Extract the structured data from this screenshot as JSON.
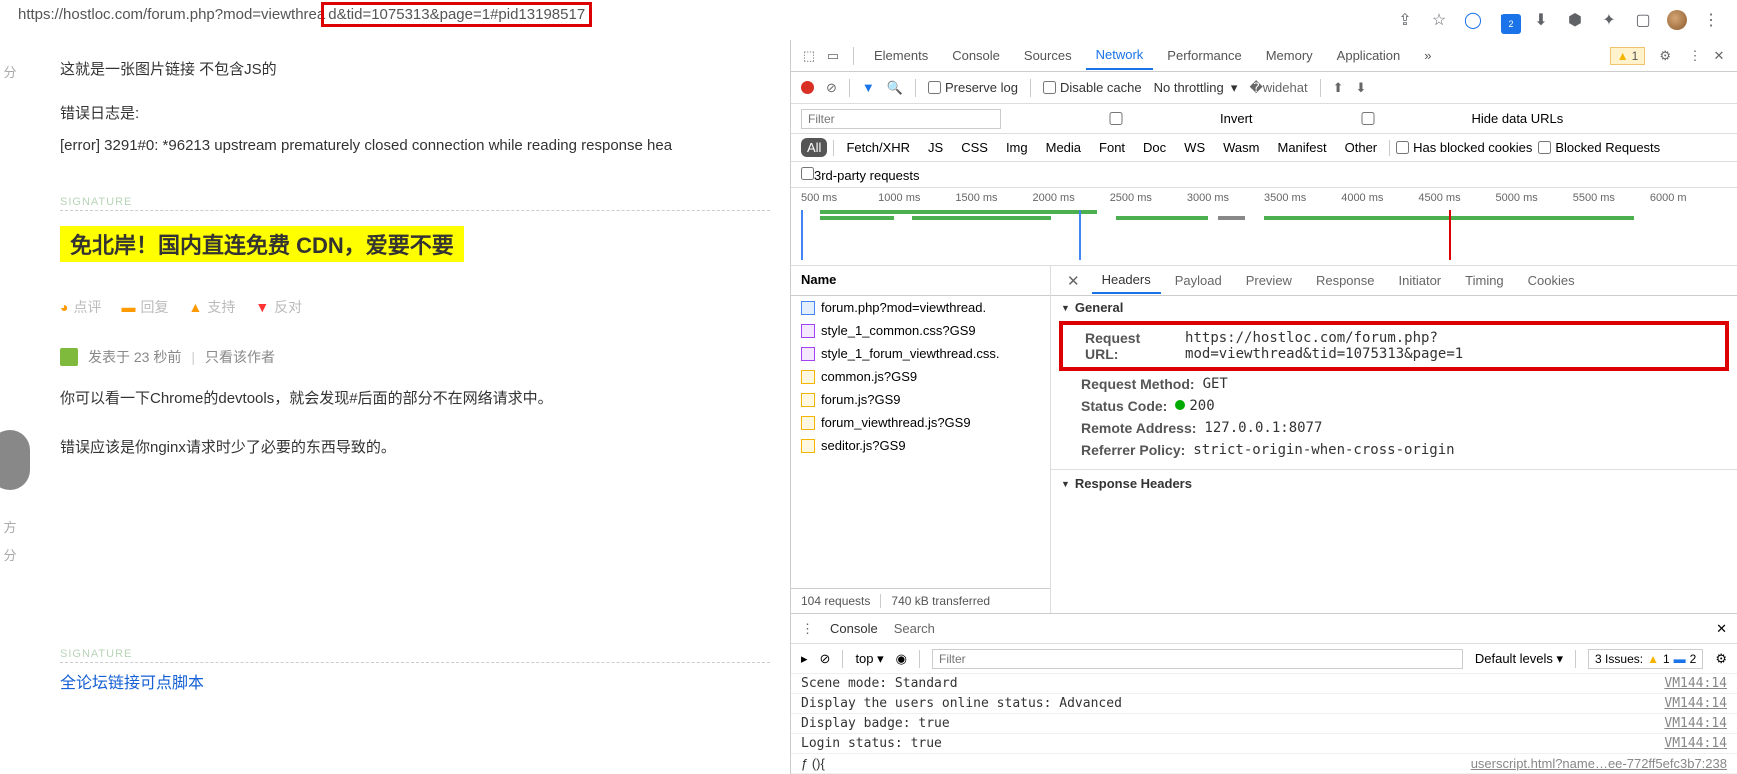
{
  "browser": {
    "url_prefix": "https://hostloc.com/forum.php?mod=viewthrea",
    "url_highlight": "d&tid=1075313&page=1#pid13198517",
    "extension_badge": "2"
  },
  "forum": {
    "sidebar1": "分",
    "sidebar2_a": "方",
    "sidebar2_b": "分",
    "post1_line1": "这就是一张图片链接   不包含JS的",
    "post1_line2": "错误日志是:",
    "post1_line3": "[error] 3291#0: *96213 upstream prematurely closed connection while reading response hea",
    "signature": "SIGNATURE",
    "banner": "免北岸！国内直连免费 CDN，爱要不要",
    "actions": {
      "comment": "点评",
      "reply": "回复",
      "support": "支持",
      "oppose": "反对"
    },
    "meta_prefix": "发表于 ",
    "meta_time": "23 秒前",
    "meta_author_only": "只看该作者",
    "post2_line1": "你可以看一下Chrome的devtools，就会发现#后面的部分不在网络请求中。",
    "post2_line2": "错误应该是你nginx请求时少了必要的东西导致的。",
    "sig_link": "全论坛链接可点脚本"
  },
  "devtools": {
    "tabs": [
      "Elements",
      "Console",
      "Sources",
      "Network",
      "Performance",
      "Memory",
      "Application"
    ],
    "active_tab": "Network",
    "warn_count": "1",
    "controls": {
      "preserve": "Preserve log",
      "disable_cache": "Disable cache",
      "throttling": "No throttling"
    },
    "filter_placeholder": "Filter",
    "invert": "Invert",
    "hide_data": "Hide data URLs",
    "types": [
      "All",
      "Fetch/XHR",
      "JS",
      "CSS",
      "Img",
      "Media",
      "Font",
      "Doc",
      "WS",
      "Wasm",
      "Manifest",
      "Other"
    ],
    "blocked_cookies": "Has blocked cookies",
    "blocked_requests": "Blocked Requests",
    "third_party": "3rd-party requests",
    "timeline_ticks": [
      "500 ms",
      "1000 ms",
      "1500 ms",
      "2000 ms",
      "2500 ms",
      "3000 ms",
      "3500 ms",
      "4000 ms",
      "4500 ms",
      "5000 ms",
      "5500 ms",
      "6000 m"
    ],
    "reqlist_header": "Name",
    "requests": [
      {
        "name": "forum.php?mod=viewthread.",
        "type": "doc"
      },
      {
        "name": "style_1_common.css?GS9",
        "type": "css"
      },
      {
        "name": "style_1_forum_viewthread.css.",
        "type": "css"
      },
      {
        "name": "common.js?GS9",
        "type": "js"
      },
      {
        "name": "forum.js?GS9",
        "type": "js"
      },
      {
        "name": "forum_viewthread.js?GS9",
        "type": "js"
      },
      {
        "name": "seditor.js?GS9",
        "type": "js"
      }
    ],
    "footer_requests": "104 requests",
    "footer_transferred": "740 kB transferred",
    "detail_tabs": [
      "Headers",
      "Payload",
      "Preview",
      "Response",
      "Initiator",
      "Timing",
      "Cookies"
    ],
    "detail_active": "Headers",
    "general_label": "General",
    "general": {
      "req_url_k": "Request URL:",
      "req_url_v": "https://hostloc.com/forum.php?mod=viewthread&tid=1075313&page=1",
      "method_k": "Request Method:",
      "method_v": "GET",
      "status_k": "Status Code:",
      "status_v": "200",
      "remote_k": "Remote Address:",
      "remote_v": "127.0.0.1:8077",
      "referrer_k": "Referrer Policy:",
      "referrer_v": "strict-origin-when-cross-origin"
    },
    "response_headers_label": "Response Headers",
    "console": {
      "tab1": "Console",
      "tab2": "Search",
      "scope": "top",
      "filter_placeholder": "Filter",
      "levels": "Default levels",
      "issues_label": "3 Issues:",
      "issues_warn": "1",
      "issues_info": "2",
      "lines": [
        {
          "msg": "Scene mode: Standard",
          "src": "VM144:14"
        },
        {
          "msg": "Display the users online status: Advanced",
          "src": "VM144:14"
        },
        {
          "msg": "Display badge: true",
          "src": "VM144:14"
        },
        {
          "msg": "Login status: true",
          "src": "VM144:14"
        }
      ],
      "prompt": "ƒ (){",
      "prompt_src": "userscript.html?name…ee-772ff5efc3b7:238"
    }
  }
}
